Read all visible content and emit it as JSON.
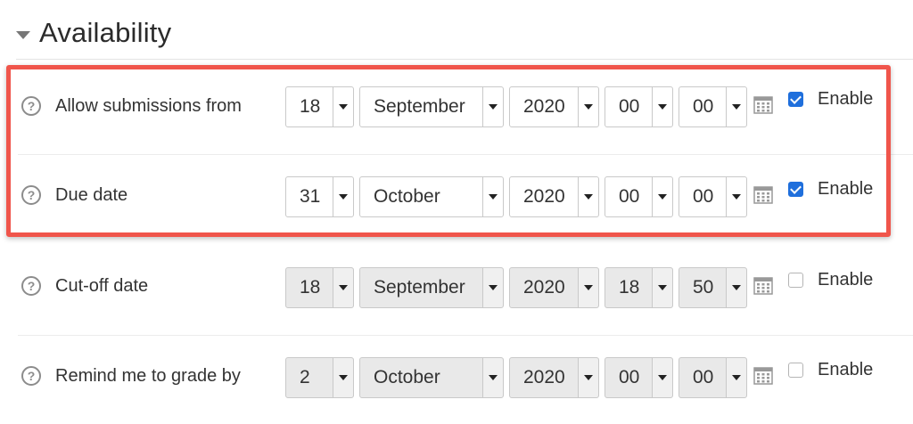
{
  "section": {
    "title": "Availability"
  },
  "rows": [
    {
      "label": "Allow submissions from",
      "day": "18",
      "month": "September",
      "year": "2020",
      "hour": "00",
      "minute": "00",
      "enabled": true,
      "enable_label": "Enable"
    },
    {
      "label": "Due date",
      "day": "31",
      "month": "October",
      "year": "2020",
      "hour": "00",
      "minute": "00",
      "enabled": true,
      "enable_label": "Enable"
    },
    {
      "label": "Cut-off date",
      "day": "18",
      "month": "September",
      "year": "2020",
      "hour": "18",
      "minute": "50",
      "enabled": false,
      "enable_label": "Enable"
    },
    {
      "label": "Remind me to grade by",
      "day": "2",
      "month": "October",
      "year": "2020",
      "hour": "00",
      "minute": "00",
      "enabled": false,
      "enable_label": "Enable"
    }
  ],
  "colors": {
    "highlight": "#f0554b",
    "checkbox_on": "#1f6fdc"
  },
  "icons": {
    "help": "question-circle-icon",
    "calendar": "calendar-icon",
    "collapse": "caret-down-icon"
  },
  "help_glyph": "?"
}
